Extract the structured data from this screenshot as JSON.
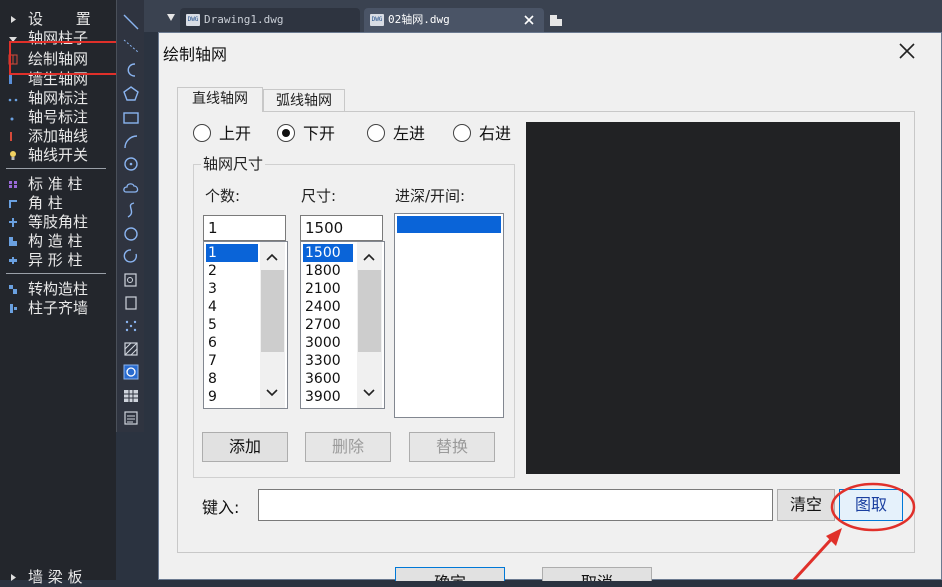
{
  "left_menu": {
    "items": [
      {
        "label": "设  置",
        "icon": "triangle-right-icon"
      },
      {
        "label": "轴网柱子",
        "icon": "triangle-down-icon"
      },
      {
        "label": "绘制轴网",
        "icon": "grid-icon"
      },
      {
        "label": "墙生轴网",
        "icon": "wall-grid-icon"
      },
      {
        "label": "轴网标注",
        "icon": "dim-icon"
      },
      {
        "label": "轴号标注",
        "icon": "axis-number-icon"
      },
      {
        "label": "添加轴线",
        "icon": "add-axis-icon"
      },
      {
        "label": "轴线开关",
        "icon": "bulb-icon"
      },
      {
        "label": "标 准 柱",
        "icon": "column-icon"
      },
      {
        "label": "角    柱",
        "icon": "corner-column-icon"
      },
      {
        "label": "等肢角柱",
        "icon": "equal-column-icon"
      },
      {
        "label": "构 造 柱",
        "icon": "structural-column-icon"
      },
      {
        "label": "异 形 柱",
        "icon": "special-column-icon"
      },
      {
        "label": "转构造柱",
        "icon": "convert-column-icon"
      },
      {
        "label": "柱子齐墙",
        "icon": "align-column-icon"
      },
      {
        "label": "墙 梁 板",
        "icon": "triangle-right-icon"
      }
    ]
  },
  "tabs": [
    {
      "label": "Drawing1.dwg",
      "active": false
    },
    {
      "label": "02轴网.dwg",
      "active": true
    }
  ],
  "dialog": {
    "title": "绘制轴网",
    "tab_straight": "直线轴网",
    "tab_arc": "弧线轴网",
    "radios": [
      "上开",
      "下开",
      "左进",
      "右进"
    ],
    "radio_selected": "下开",
    "group_title": "轴网尺寸",
    "col_count": "个数:",
    "col_size": "尺寸:",
    "col_depth": "进深/开间:",
    "count_value": "1",
    "size_value": "1500",
    "count_list": [
      "1",
      "2",
      "3",
      "4",
      "5",
      "6",
      "7",
      "8",
      "9"
    ],
    "size_list": [
      "1500",
      "1800",
      "2100",
      "2400",
      "2700",
      "3000",
      "3300",
      "3600",
      "3900"
    ],
    "btn_add": "添加",
    "btn_delete": "删除",
    "btn_replace": "替换",
    "input_label": "键入:",
    "btn_clear": "清空",
    "btn_pick": "图取",
    "btn_ok": "确定",
    "btn_cancel": "取消"
  },
  "colors": {
    "highlight": "#e0302a",
    "selection": "#0a64d8"
  }
}
